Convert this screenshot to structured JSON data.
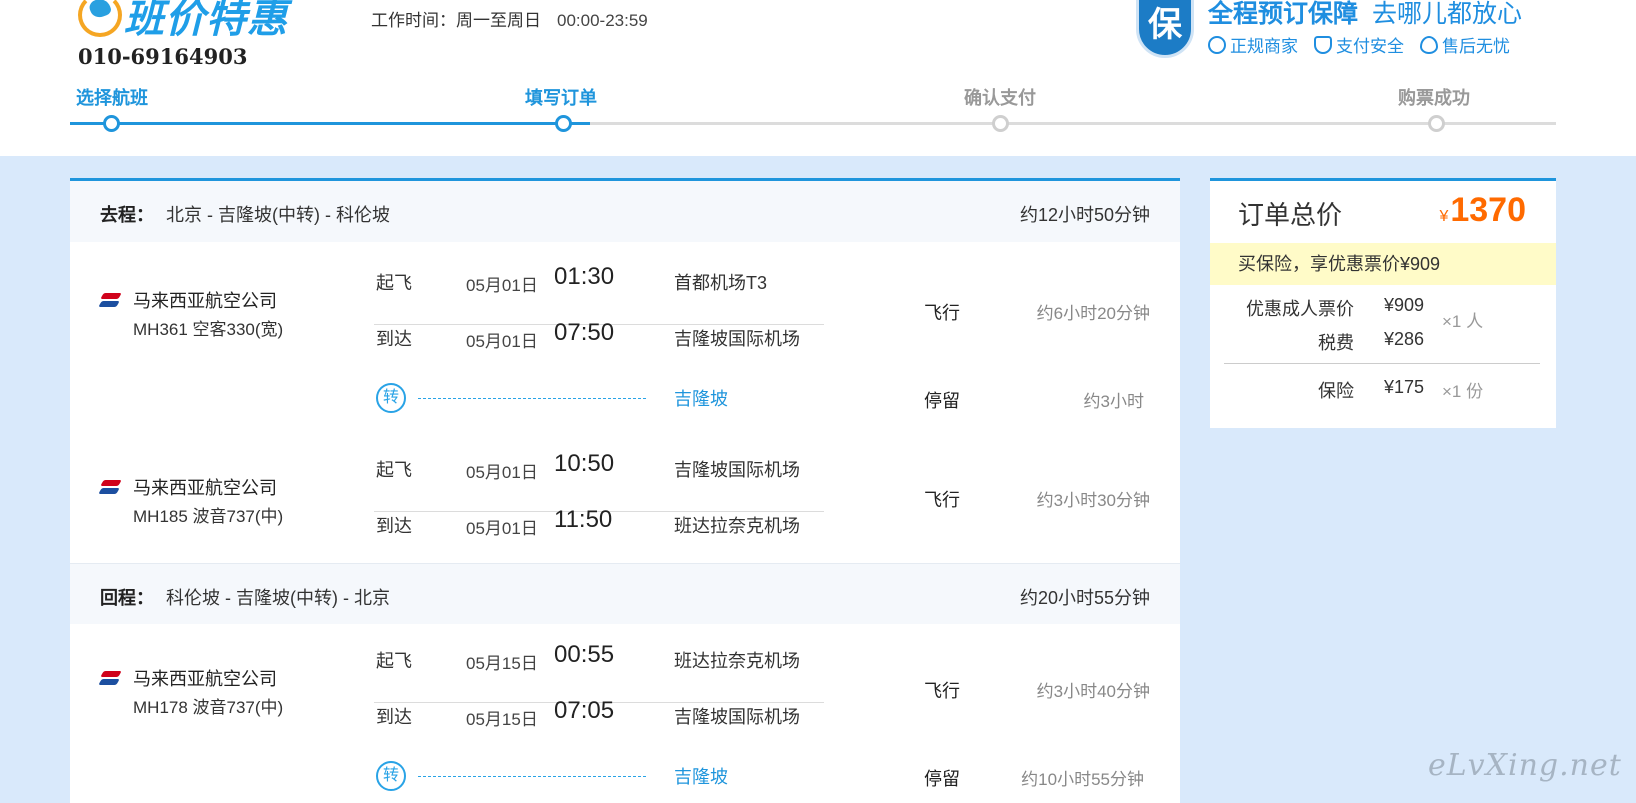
{
  "header": {
    "brand": "班价特惠",
    "hotline": "010-69164903",
    "worktime_label": "工作时间：周一至周日",
    "worktime_hours": "00:00-23:59",
    "guarantee_badge": "保",
    "guarantee_title": "全程预订保障",
    "guarantee_sub": "去哪儿都放心",
    "guarantee_items": [
      "正规商家",
      "支付安全",
      "售后无忧"
    ]
  },
  "steps": [
    {
      "label": "选择航班",
      "active": true
    },
    {
      "label": "填写订单",
      "active": true
    },
    {
      "label": "确认支付",
      "active": false
    },
    {
      "label": "购票成功",
      "active": false
    }
  ],
  "outbound": {
    "kind": "去程：",
    "route": "北京 - 吉隆坡(中转) - 科伦坡",
    "duration": "约12小时50分钟",
    "flights": [
      {
        "airline": "马来西亚航空公司",
        "flight": "MH361  空客330(宽)",
        "dep": {
          "label": "起飞",
          "date": "05月01日",
          "time": "01:30",
          "airport": "首都机场T3"
        },
        "arr": {
          "label": "到达",
          "date": "05月01日",
          "time": "07:50",
          "airport": "吉隆坡国际机场"
        },
        "fly_label": "飞行",
        "fly_duration": "约6小时20分钟"
      },
      {
        "airline": "马来西亚航空公司",
        "flight": "MH185  波音737(中)",
        "dep": {
          "label": "起飞",
          "date": "05月01日",
          "time": "10:50",
          "airport": "吉隆坡国际机场"
        },
        "arr": {
          "label": "到达",
          "date": "05月01日",
          "time": "11:50",
          "airport": "班达拉奈克机场"
        },
        "fly_label": "飞行",
        "fly_duration": "约3小时30分钟"
      }
    ],
    "transfer": {
      "icon": "转",
      "city": "吉隆坡",
      "stay_label": "停留",
      "stay_duration": "约3小时"
    }
  },
  "return": {
    "kind": "回程：",
    "route": "科伦坡 - 吉隆坡(中转) - 北京",
    "duration": "约20小时55分钟",
    "flights": [
      {
        "airline": "马来西亚航空公司",
        "flight": "MH178  波音737(中)",
        "dep": {
          "label": "起飞",
          "date": "05月15日",
          "time": "00:55",
          "airport": "班达拉奈克机场"
        },
        "arr": {
          "label": "到达",
          "date": "05月15日",
          "time": "07:05",
          "airport": "吉隆坡国际机场"
        },
        "fly_label": "飞行",
        "fly_duration": "约3小时40分钟"
      }
    ],
    "transfer": {
      "icon": "转",
      "city": "吉隆坡",
      "stay_label": "停留",
      "stay_duration": "约10小时55分钟"
    }
  },
  "price": {
    "title": "订单总价",
    "currency": "¥",
    "total": "1370",
    "promo": "买保险，享优惠票价¥909",
    "rows": [
      {
        "key": "优惠成人票价",
        "value": "¥909",
        "qty": "×1 人"
      },
      {
        "key": "税费",
        "value": "¥286",
        "qty": ""
      },
      {
        "key": "保险",
        "value": "¥175",
        "qty": "×1 份"
      }
    ]
  },
  "watermark": "eLvXing.net"
}
